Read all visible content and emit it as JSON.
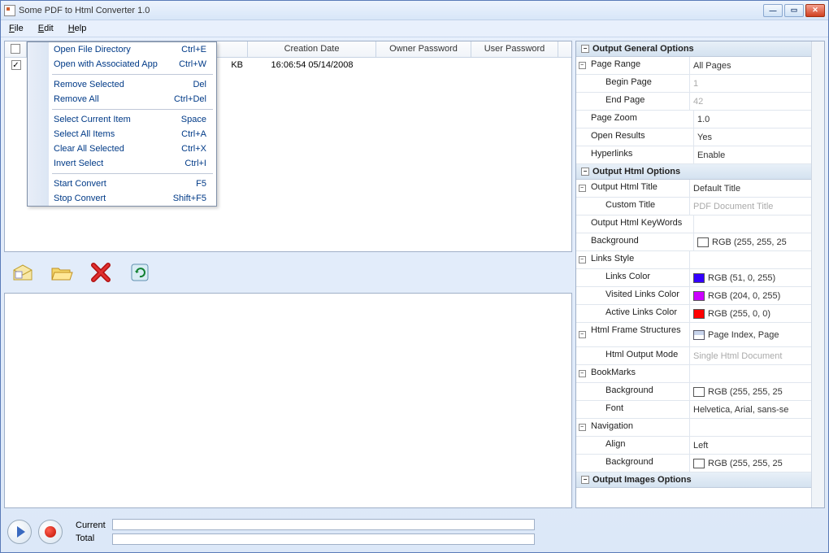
{
  "window": {
    "title": "Some PDF to Html Converter 1.0"
  },
  "menubar": {
    "file": "File",
    "edit": "Edit",
    "help": "Help"
  },
  "edit_menu": {
    "items": [
      {
        "label": "Open File Directory",
        "shortcut": "Ctrl+E"
      },
      {
        "label": "Open with Associated App",
        "shortcut": "Ctrl+W"
      },
      {
        "sep": true
      },
      {
        "label": "Remove Selected",
        "shortcut": "Del"
      },
      {
        "label": "Remove All",
        "shortcut": "Ctrl+Del"
      },
      {
        "sep": true
      },
      {
        "label": "Select Current Item",
        "shortcut": "Space"
      },
      {
        "label": "Select All Items",
        "shortcut": "Ctrl+A"
      },
      {
        "label": "Clear All Selected",
        "shortcut": "Ctrl+X"
      },
      {
        "label": "Invert Select",
        "shortcut": "Ctrl+I"
      },
      {
        "sep": true
      },
      {
        "label": "Start Convert",
        "shortcut": "F5"
      },
      {
        "label": "Stop Convert",
        "shortcut": "Shift+F5"
      }
    ]
  },
  "table": {
    "headers": {
      "check": "",
      "filename": "",
      "size": "KB",
      "creation": "Creation Date",
      "owner": "Owner Password",
      "user": "User Password"
    },
    "rows": [
      {
        "checked": true,
        "size": "KB",
        "creation": "16:06:54 05/14/2008",
        "owner": "",
        "user": ""
      }
    ]
  },
  "props": {
    "general": {
      "header": "Output General Options",
      "page_range": {
        "label": "Page Range",
        "value": "All Pages"
      },
      "begin_page": {
        "label": "Begin Page",
        "value": "1"
      },
      "end_page": {
        "label": "End Page",
        "value": "42"
      },
      "page_zoom": {
        "label": "Page Zoom",
        "value": "1.0"
      },
      "open_results": {
        "label": "Open Results",
        "value": "Yes"
      },
      "hyperlinks": {
        "label": "Hyperlinks",
        "value": "Enable"
      }
    },
    "html": {
      "header": "Output Html Options",
      "title": {
        "label": "Output Html Title",
        "value": "Default Title"
      },
      "custom_title": {
        "label": "Custom Title",
        "value": "PDF Document Title"
      },
      "keywords": {
        "label": "Output Html KeyWords",
        "value": ""
      },
      "background": {
        "label": "Background",
        "value": "RGB (255, 255, 25",
        "color": "#ffffff"
      },
      "links_style": {
        "label": "Links Style"
      },
      "links_color": {
        "label": "Links Color",
        "value": "RGB (51, 0, 255)",
        "color": "#3300ff"
      },
      "visited_color": {
        "label": "Visited Links Color",
        "value": "RGB (204, 0, 255)",
        "color": "#cc00ff"
      },
      "active_color": {
        "label": "Active Links Color",
        "value": "RGB (255, 0, 0)",
        "color": "#ff0000"
      },
      "frame": {
        "label": "Html Frame Structures",
        "value": "Page Index, Page"
      },
      "output_mode": {
        "label": "Html Output Mode",
        "value": "Single Html Document"
      },
      "bookmarks": {
        "label": "BookMarks"
      },
      "bm_background": {
        "label": "Background",
        "value": "RGB (255, 255, 25",
        "color": "#ffffff"
      },
      "bm_font": {
        "label": "Font",
        "value": "Helvetica, Arial, sans-se"
      },
      "navigation": {
        "label": "Navigation"
      },
      "nav_align": {
        "label": "Align",
        "value": "Left"
      },
      "nav_background": {
        "label": "Background",
        "value": "RGB (255, 255, 25",
        "color": "#ffffff"
      }
    },
    "images": {
      "header": "Output Images Options"
    }
  },
  "bottom": {
    "current": "Current",
    "total": "Total"
  }
}
